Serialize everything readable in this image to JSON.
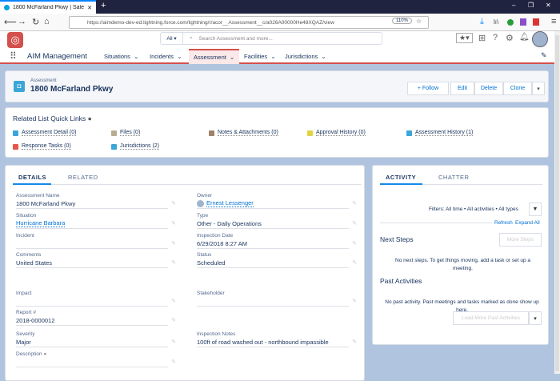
{
  "browser": {
    "tab_title": "1800 McFarland Pkwy | Salesfo",
    "url": "https://aimdemo-dev-ed.lightning.force.com/lightning/r/acor__Assessment__c/a026A00000He48XQAZ/view",
    "zoom": "110%"
  },
  "header": {
    "search_scope": "All",
    "search_placeholder": "Search Assessment and more..."
  },
  "nav": {
    "app_name": "AIM Management",
    "items": [
      "Situations",
      "Incidents",
      "Assessment",
      "Facilities",
      "Jurisdictions"
    ]
  },
  "record": {
    "object": "Assessment",
    "title": "1800 McFarland Pkwy",
    "buttons": {
      "follow": "+ Follow",
      "edit": "Edit",
      "delete": "Delete",
      "clone": "Clone"
    }
  },
  "quick_links": {
    "title": "Related List Quick Links",
    "links": [
      "Assessment Detail (0)",
      "Files (0)",
      "Notes & Attachments (0)",
      "Approval History (0)",
      "Assessment History (1)",
      "Response Tasks (0)",
      "Jurisdictions (2)"
    ]
  },
  "colors": {
    "brand_red": "#d4504c",
    "link": "#0070d2",
    "bg": "#b0c4df"
  },
  "details": {
    "tabs": [
      "DETAILS",
      "RELATED"
    ],
    "fields": [
      {
        "label": "Assessment Name",
        "value": "1800 McFarland Pkwy"
      },
      {
        "label": "Owner",
        "value": "Ernest Lessenger"
      },
      {
        "label": "Situation",
        "value": "Hurricane Barbara"
      },
      {
        "label": "Type",
        "value": "Other - Daily Operations"
      },
      {
        "label": "Incident",
        "value": ""
      },
      {
        "label": "Inspection Date",
        "value": "6/29/2018 8:27 AM"
      },
      {
        "label": "Comments",
        "value": "United States"
      },
      {
        "label": "Status",
        "value": "Scheduled"
      },
      {
        "label": "Impact",
        "value": ""
      },
      {
        "label": "Stakeholder",
        "value": ""
      },
      {
        "label": "Report #",
        "value": "2018-0000012"
      },
      {
        "label": "Severity",
        "value": "Major"
      },
      {
        "label": "Inspection Notes",
        "value": "100ft of road washed out - northbound impassible"
      },
      {
        "label": "Description",
        "value": ""
      }
    ]
  },
  "activity": {
    "tabs": [
      "ACTIVITY",
      "CHATTER"
    ],
    "filters": "Filters: All time • All activities • All types",
    "refresh": "Refresh",
    "expand_all": "Expand All",
    "next_steps": "Next Steps",
    "more_steps": "More Steps",
    "next_empty": "No next steps. To get things moving, add a task or set up a meeting.",
    "past": "Past Activities",
    "past_empty": "No past activity. Past meetings and tasks marked as done show up here.",
    "load_more": "Load More Past Activities"
  }
}
